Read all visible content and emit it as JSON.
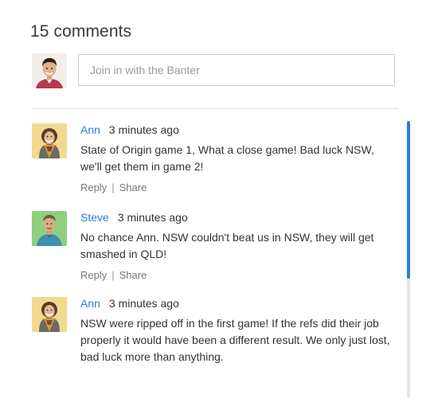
{
  "header": {
    "title": "15 comments"
  },
  "compose": {
    "placeholder": "Join in with the Banter",
    "avatar_icon": "user-avatar-icon"
  },
  "comments": [
    {
      "author": "Ann",
      "time": "3 minutes ago",
      "text": "State of Origin game 1, What a close game! Bad luck NSW, we'll get them in game 2!",
      "reply_label": "Reply",
      "share_label": "Share",
      "separator": "|"
    },
    {
      "author": "Steve",
      "time": "3 minutes ago",
      "text": "No chance Ann. NSW couldn't beat us in NSW, they will get smashed in QLD!",
      "reply_label": "Reply",
      "share_label": "Share",
      "separator": "|"
    },
    {
      "author": "Ann",
      "time": "3 minutes ago",
      "text": "NSW were ripped off in the first game! If the refs did their job properly it would have been a different result. We only just lost, bad luck more than anything."
    }
  ],
  "colors": {
    "accent": "#2a7de1",
    "text": "#333333",
    "muted": "#777777",
    "border": "#c9c9c9"
  }
}
